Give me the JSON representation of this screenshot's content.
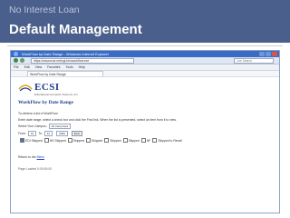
{
  "slide": {
    "subtitle": "No Interest Loan",
    "title": "Default Management"
  },
  "browser": {
    "window_title": "WorkFlow by Date Range - Windows Internet Explorer",
    "address": "https://www.ecsi.net/cgi-bin/workflow.exe",
    "search_placeholder": "Live Search",
    "menu": [
      "File",
      "Edit",
      "View",
      "Favorites",
      "Tools",
      "Help"
    ],
    "tab_label": "WorkFlow by Date Range"
  },
  "page": {
    "logo_text": "ECSI",
    "logo_tagline": "Educational Computer Systems, Inc.",
    "heading": "WorkFlow by Date Range",
    "intro": "To retrieve a list of WorkFlow:",
    "instructions": "Enter date range, select a check box and click the Find link. When the list is presented, select an item from it to view.",
    "filter": {
      "label": "Select Your Campus:",
      "value": "All Campuses"
    },
    "date_range": {
      "from_label": "From:",
      "from_value": "10",
      "to_label": "To:",
      "to_value": "12",
      "year_value": "2009",
      "find_label": "Find"
    },
    "checkboxes": [
      {
        "label": "EDI Skipped",
        "checked": true
      },
      {
        "label": "NS Skipped",
        "checked": false
      },
      {
        "label": "Skipped",
        "checked": false
      },
      {
        "label": "Skipped",
        "checked": false
      },
      {
        "label": "Skipped",
        "checked": false
      },
      {
        "label": "Skipped",
        "checked": false
      },
      {
        "label": "NF",
        "checked": false
      },
      {
        "label": "Skipped to Recall",
        "checked": false
      }
    ],
    "return_text": "Return to the",
    "return_link": "Menu",
    "footer": "Page Loaded 0:00:00:00"
  }
}
